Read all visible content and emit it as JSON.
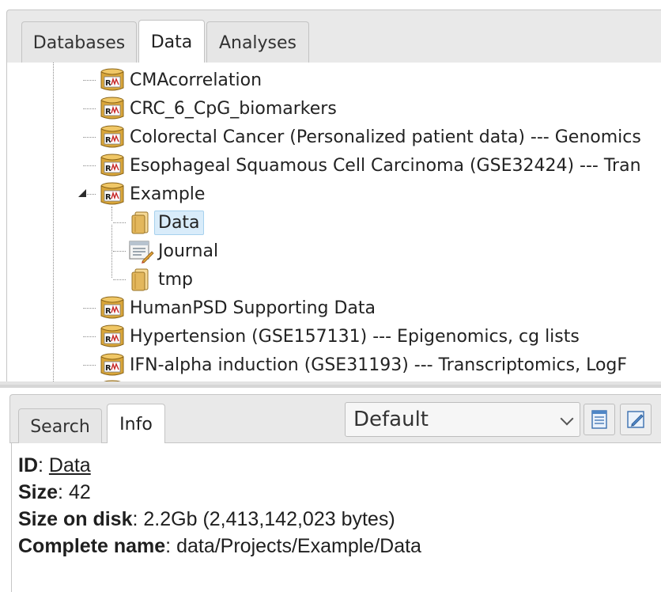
{
  "top_tabs": [
    {
      "label": "Databases"
    },
    {
      "label": "Data"
    },
    {
      "label": "Analyses"
    }
  ],
  "tree": {
    "items": [
      {
        "label": "CMAcorrelation",
        "icon": "database-icon"
      },
      {
        "label": "CRC_6_CpG_biomarkers",
        "icon": "database-icon"
      },
      {
        "label": "Colorectal Cancer (Personalized patient data) --- Genomics",
        "icon": "database-icon"
      },
      {
        "label": "Esophageal Squamous Cell Carcinoma (GSE32424) --- Tran",
        "icon": "database-icon"
      },
      {
        "label": "Example",
        "icon": "database-icon",
        "expanded": true
      },
      {
        "label": "Data",
        "icon": "folder-icon",
        "selected": true
      },
      {
        "label": "Journal",
        "icon": "journal-icon"
      },
      {
        "label": "tmp",
        "icon": "folder-icon"
      },
      {
        "label": "HumanPSD Supporting Data",
        "icon": "database-icon"
      },
      {
        "label": "Hypertension (GSE157131) --- Epigenomics, cg lists",
        "icon": "database-icon"
      },
      {
        "label": "IFN-alpha induction (GSE31193) --- Transcriptomics, LogF",
        "icon": "database-icon"
      }
    ]
  },
  "bottom_tabs": [
    {
      "label": "Search"
    },
    {
      "label": "Info"
    }
  ],
  "view_select": {
    "value": "Default"
  },
  "toolbar": {
    "icons": [
      "document-icon",
      "edit-icon"
    ]
  },
  "info": {
    "id_label": "ID",
    "id_value": "Data",
    "size_label": "Size",
    "size_value": "42",
    "disk_label": "Size on disk",
    "disk_value": "2.2Gb (2,413,142,023 bytes)",
    "name_label": "Complete name",
    "name_value": "data/Projects/Example/Data"
  },
  "colors": {
    "selection": "#d9ecfa",
    "database_icon": "#d9a63a",
    "folder_icon": "#e3b75c"
  }
}
